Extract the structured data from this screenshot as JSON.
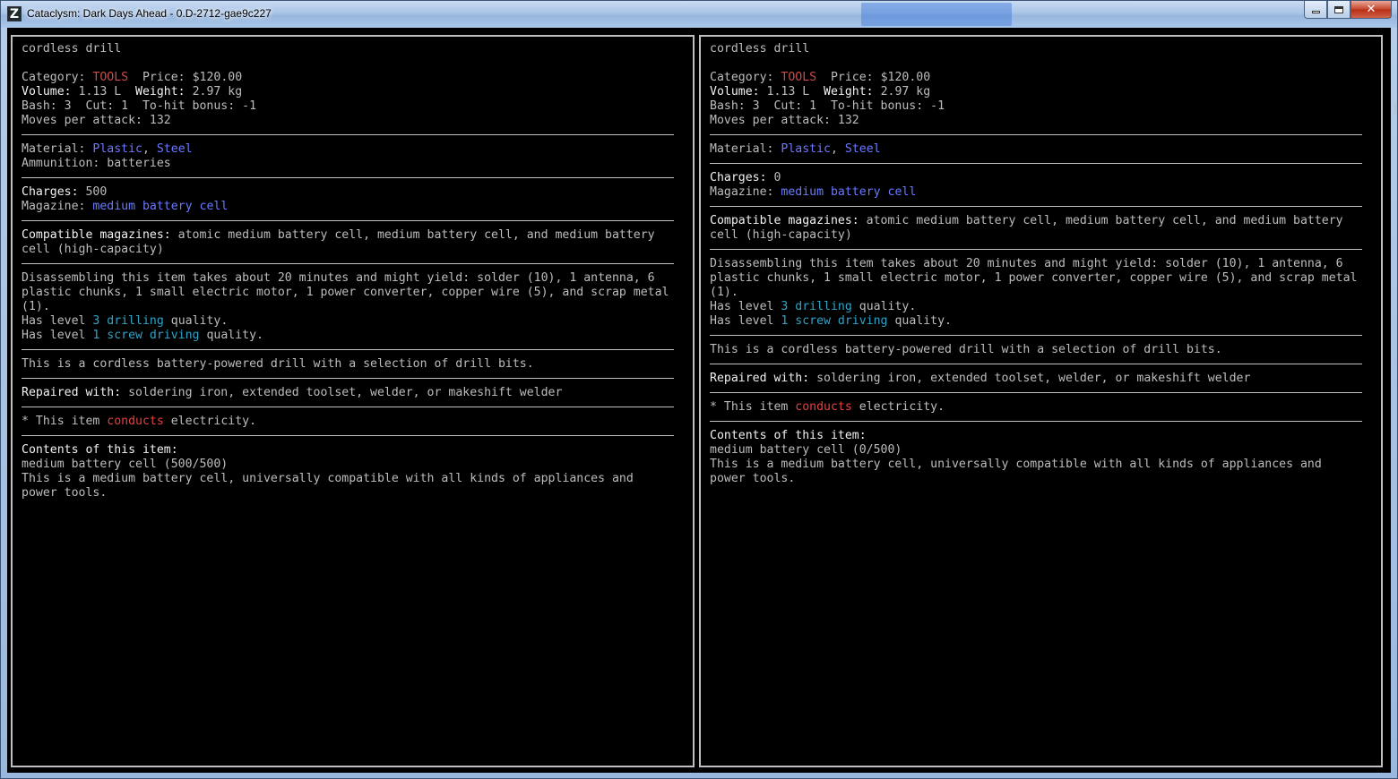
{
  "window": {
    "icon": "Z",
    "title": "Cataclysm: Dark Days Ahead - 0.D-2712-gae9c227",
    "controls": {
      "minimize": "minimize-icon",
      "maximize": "maximize-icon",
      "close": "close-icon",
      "close_glyph": "✕"
    }
  },
  "colors": {
    "text": "#bdbdbd",
    "highlight": "#f2f2f2",
    "category": "#cc4a4a",
    "material": "#6c78ff",
    "quality": "#2fa3c8",
    "conducts": "#e84040"
  },
  "edge_glyph": ")",
  "left": {
    "name": "cordless drill",
    "category_label": "Category: ",
    "category_value": "TOOLS",
    "price_label": "  Price: ",
    "price_value": "$120.00",
    "volume_label": "Volume:",
    "volume_value": " 1.13 L  ",
    "weight_label": "Weight:",
    "weight_value": " 2.97 kg",
    "bash_line": "Bash: 3  Cut: 1  To-hit bonus: -1",
    "moves_line": "Moves per attack: 132",
    "material_label": "Material: ",
    "material_1": "Plastic",
    "material_sep": ", ",
    "material_2": "Steel",
    "ammo_line": "Ammunition: batteries",
    "charges_label": "Charges:",
    "charges_value": " 500",
    "magazine_label": "Magazine: ",
    "magazine_value": "medium battery cell",
    "compat_label": "Compatible magazines:",
    "compat_text": " atomic medium battery cell, medium battery cell, and medium battery\ncell (high-capacity)",
    "disassemble_text": "Disassembling this item takes about 20 minutes and might yield: solder (10), 1 antenna, 6\nplastic chunks, 1 small electric motor, 1 power converter, copper wire (5), and scrap metal\n(1).",
    "q1_prefix": "Has level ",
    "q1_value": "3 drilling",
    "q1_suffix": " quality.",
    "q2_prefix": "Has level ",
    "q2_value": "1 screw driving",
    "q2_suffix": " quality.",
    "description": "This is a cordless battery-powered drill with a selection of drill bits.",
    "repaired_label": "Repaired with:",
    "repaired_text": " soldering iron, extended toolset, welder, or makeshift welder",
    "conduct_prefix": "* This item ",
    "conduct_word": "conducts",
    "conduct_suffix": " electricity.",
    "contents_label": "Contents of this item:",
    "contents_item": "medium battery cell (500/500)",
    "contents_desc": "This is a medium battery cell, universally compatible with all kinds of appliances and\npower tools."
  },
  "right": {
    "name": "cordless drill",
    "category_label": "Category: ",
    "category_value": "TOOLS",
    "price_label": "  Price: ",
    "price_value": "$120.00",
    "volume_label": "Volume:",
    "volume_value": " 1.13 L  ",
    "weight_label": "Weight:",
    "weight_value": " 2.97 kg",
    "bash_line": "Bash: 3  Cut: 1  To-hit bonus: -1",
    "moves_line": "Moves per attack: 132",
    "material_label": "Material: ",
    "material_1": "Plastic",
    "material_sep": ", ",
    "material_2": "Steel",
    "charges_label": "Charges:",
    "charges_value": " 0",
    "magazine_label": "Magazine: ",
    "magazine_value": "medium battery cell",
    "compat_label": "Compatible magazines:",
    "compat_text": " atomic medium battery cell, medium battery cell, and medium battery\ncell (high-capacity)",
    "disassemble_text": "Disassembling this item takes about 20 minutes and might yield: solder (10), 1 antenna, 6\nplastic chunks, 1 small electric motor, 1 power converter, copper wire (5), and scrap metal\n(1).",
    "q1_prefix": "Has level ",
    "q1_value": "3 drilling",
    "q1_suffix": " quality.",
    "q2_prefix": "Has level ",
    "q2_value": "1 screw driving",
    "q2_suffix": " quality.",
    "description": "This is a cordless battery-powered drill with a selection of drill bits.",
    "repaired_label": "Repaired with:",
    "repaired_text": " soldering iron, extended toolset, welder, or makeshift welder",
    "conduct_prefix": "* This item ",
    "conduct_word": "conducts",
    "conduct_suffix": " electricity.",
    "contents_label": "Contents of this item:",
    "contents_item": "medium battery cell (0/500)",
    "contents_desc": "This is a medium battery cell, universally compatible with all kinds of appliances and\npower tools."
  }
}
